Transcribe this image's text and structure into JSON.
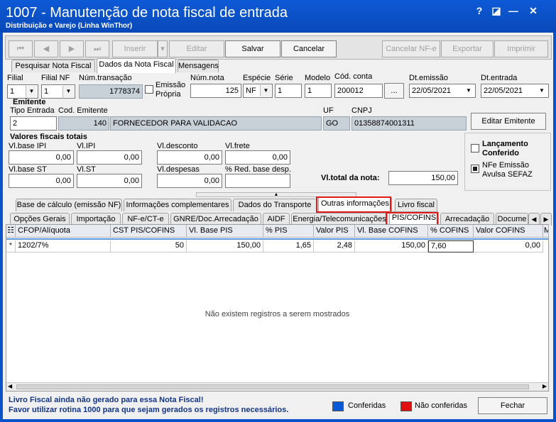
{
  "window": {
    "title": "1007 - Manutenção de nota fiscal de entrada",
    "subtitle": "Distribuição e Varejo (Linha WinThor)",
    "controls": {
      "help": "?",
      "restore": "◪",
      "minimize": "—",
      "close": "✕"
    }
  },
  "toolbar": {
    "first": "⏮",
    "prev": "◀",
    "next": "▶",
    "last": "⏭",
    "inserir": "Inserir",
    "editar": "Editar",
    "salvar": "Salvar",
    "cancelar": "Cancelar",
    "cancelar_nfe": "Cancelar NF-e",
    "exportar": "Exportar",
    "imprimir": "Imprimir"
  },
  "main_tabs": [
    "Pesquisar Nota Fiscal",
    "Dados da Nota Fiscal",
    "Mensagens"
  ],
  "form": {
    "filial": {
      "label": "Filial",
      "value": "1"
    },
    "filial_nf": {
      "label": "Filial NF",
      "value": "1"
    },
    "num_transacao": {
      "label": "Núm.transação",
      "value": "1778374"
    },
    "emissao_propria": {
      "label1": "Emissão",
      "label2": "Própria"
    },
    "num_nota": {
      "label": "Núm.nota",
      "value": "125"
    },
    "especie": {
      "label": "Espécie",
      "value": "NF"
    },
    "serie": {
      "label": "Série",
      "value": "1"
    },
    "modelo": {
      "label": "Modelo",
      "value": "1"
    },
    "cod_conta": {
      "label": "Cód. conta",
      "value": "200012",
      "btn": "..."
    },
    "dt_emissao": {
      "label": "Dt.emissão",
      "value": "22/05/2021"
    },
    "dt_entrada": {
      "label": "Dt.entrada",
      "value": "22/05/2021"
    }
  },
  "emitente": {
    "group": "Emitente",
    "tipo_entrada_label": "Tipo Entrada",
    "tipo_entrada": "2",
    "cod_label": "Cod. Emitente",
    "cod": "140",
    "nome": "FORNECEDOR PARA VALIDACAO",
    "uf_label": "UF",
    "uf": "GO",
    "cnpj_label": "CNPJ",
    "cnpj": "01358874001311",
    "edit_btn": "Editar Emitente"
  },
  "valores": {
    "group": "Valores fiscais totais",
    "base_ipi": {
      "label": "Vl.base IPI",
      "value": "0,00"
    },
    "ipi": {
      "label": "Vl.IPI",
      "value": "0,00"
    },
    "desconto": {
      "label": "Vl.desconto",
      "value": "0,00"
    },
    "frete": {
      "label": "Vl.frete",
      "value": "0,00"
    },
    "base_st": {
      "label": "Vl.base ST",
      "value": "0,00"
    },
    "st": {
      "label": "Vl.ST",
      "value": "0,00"
    },
    "despesas": {
      "label": "Vl.despesas",
      "value": "0,00"
    },
    "red_base": {
      "label": "% Red. base desp.",
      "value": ""
    },
    "total": {
      "label": "Vl.total da nota:",
      "value": "150,00"
    }
  },
  "side_options": {
    "lancamento1": "Lançamento",
    "lancamento2": "Conferido",
    "nfe1": "NFe Emissão",
    "nfe2": "Avulsa SEFAZ"
  },
  "tabs_row1": [
    "Base de cálculo (emissão NF)",
    "Informações complementares",
    "Dados do Transporte",
    "Outras informações",
    "Livro fiscal"
  ],
  "tabs_row2": [
    "Opções Gerais",
    "Importação",
    "NF-e/CT-e",
    "GNRE/Doc.Arrecadação",
    "AIDF",
    "Energia/Telecomunicações",
    "PIS/COFINS",
    "Arrecadação",
    "Docume"
  ],
  "grid": {
    "headers": [
      "CFOP/Alíquota",
      "CST PIS/COFINS",
      "Vl. Base PIS",
      "% PIS",
      "Valor PIS",
      "Vl. Base COFINS",
      "% COFINS",
      "Valor COFINS",
      "M"
    ],
    "row": [
      "1202/7%",
      "50",
      "150,00",
      "1,65",
      "2,48",
      "150,00",
      "7,60",
      "0,00"
    ],
    "row_marker": "*",
    "empty": "Não existem registros a serem mostrados"
  },
  "footer": {
    "warning1": "Livro Fiscal ainda não gerado para essa Nota Fiscal!",
    "warning2": "Favor utilizar rotina 1000 para que sejam gerados os registros necessários.",
    "legend_conferidas": "Conferidas",
    "legend_nao": "Não conferidas",
    "fechar": "Fechar"
  },
  "colors": {
    "conferidas": "#0a5ad8",
    "nao_conferidas": "#e01010",
    "highlight": "#e01818"
  }
}
